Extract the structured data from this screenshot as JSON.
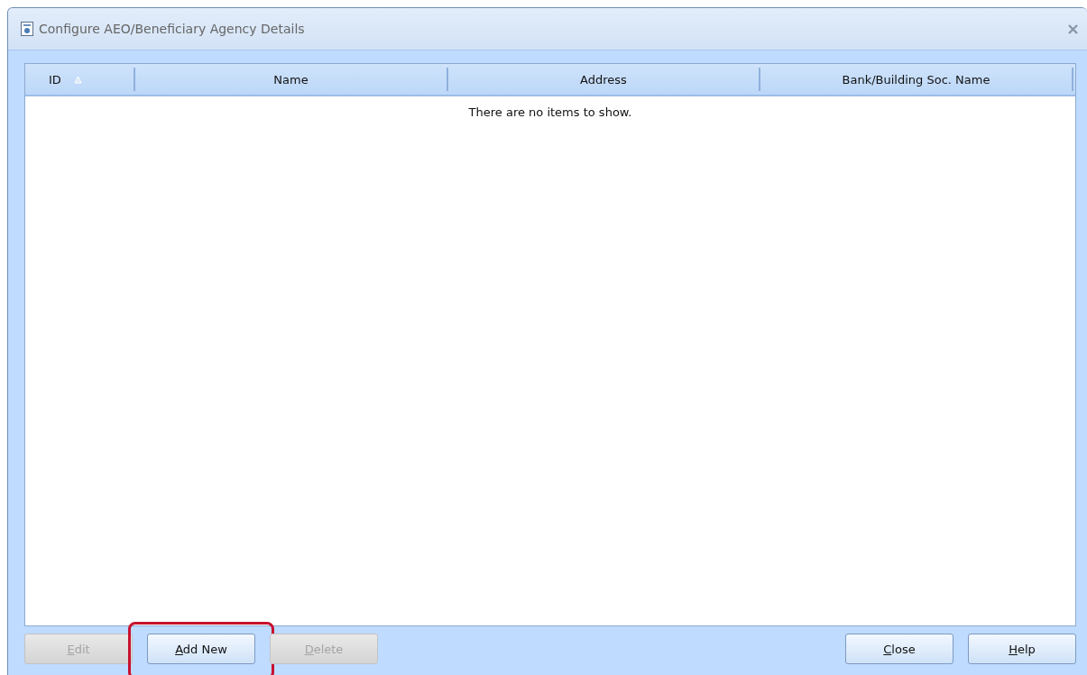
{
  "window": {
    "title": "Configure AEO/Beneficiary Agency Details"
  },
  "table": {
    "columns": [
      {
        "label": "ID",
        "sorted_ascending": true
      },
      {
        "label": "Name",
        "sorted_ascending": false
      },
      {
        "label": "Address",
        "sorted_ascending": false
      },
      {
        "label": "Bank/Building Soc. Name",
        "sorted_ascending": false
      }
    ],
    "empty_message": "There are no items to show."
  },
  "buttons_left": [
    {
      "label": "Edit",
      "disabled": true,
      "highlighted": false,
      "access_key": true
    },
    {
      "label": "Add New",
      "disabled": false,
      "highlighted": true,
      "access_key": true
    },
    {
      "label": "Delete",
      "disabled": true,
      "highlighted": false,
      "access_key": true
    }
  ],
  "buttons_right": [
    {
      "label": "Close",
      "disabled": false,
      "highlighted": false,
      "access_key": true
    },
    {
      "label": "Help",
      "disabled": false,
      "highlighted": false,
      "access_key": true
    }
  ]
}
